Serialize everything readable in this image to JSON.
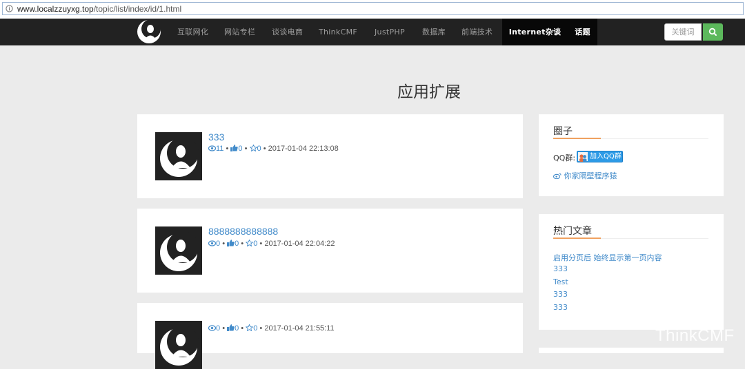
{
  "browser": {
    "url_domain": "www.localzzuyxg.top",
    "url_path": "/topic/list/index/id/1.html"
  },
  "nav": {
    "items": [
      {
        "label": "互联网化"
      },
      {
        "label": "网站专栏"
      },
      {
        "label": "谈谈电商"
      },
      {
        "label": "ThinkCMF"
      },
      {
        "label": "JustPHP"
      },
      {
        "label": "数据库"
      },
      {
        "label": "前端技术"
      },
      {
        "label": "Internet杂谈"
      },
      {
        "label": "话题"
      }
    ],
    "search_placeholder": "关键词",
    "search_icon": "search-icon"
  },
  "page": {
    "title": "应用扩展"
  },
  "posts": [
    {
      "title": "333",
      "views": "11",
      "likes": "0",
      "favorites": "0",
      "date": "2017-01-04 22:13:08"
    },
    {
      "title": "8888888888888",
      "views": "0",
      "likes": "0",
      "favorites": "0",
      "date": "2017-01-04 22:04:22"
    },
    {
      "title": "",
      "views": "0",
      "likes": "0",
      "favorites": "0",
      "date": "2017-01-04 21:55:11"
    }
  ],
  "sidebar": {
    "circle": {
      "title": "圈子",
      "qq_label": "QQ群:",
      "qq_button": "加入QQ群",
      "weibo_link": "你家隔壁程序猿"
    },
    "hot": {
      "title": "热门文章",
      "links": [
        "启用分页后 始终显示第一页内容",
        "333",
        "Test",
        "333",
        "333"
      ]
    }
  },
  "watermark": "ThinkCMF",
  "colors": {
    "navbar": "#222222",
    "link": "#428bca",
    "search_button": "#5cb85c",
    "accent_rule": "#f0a15f"
  }
}
